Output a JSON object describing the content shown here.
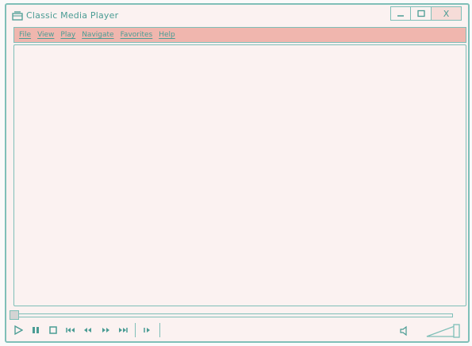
{
  "window": {
    "title": "Classic Media Player",
    "controls": [
      "minimize",
      "maximize",
      "close"
    ],
    "close_label": "X"
  },
  "menu": {
    "items": [
      "File",
      "View",
      "Play",
      "Navigate",
      "Favorites",
      "Help"
    ]
  },
  "seek": {
    "position_fraction": 0.0
  },
  "volume": {
    "level_fraction": 1.0
  },
  "icons": {
    "app": "media-player-icon",
    "play": "play-icon",
    "pause": "pause-icon",
    "stop": "stop-icon",
    "previous": "skip-previous-icon",
    "rewind": "rewind-icon",
    "forward": "fast-forward-icon",
    "next": "skip-next-icon",
    "frame_step": "frame-step-icon",
    "speaker": "speaker-icon"
  },
  "colors": {
    "accent": "#7fbfb8",
    "menubar": "#f0b6ae",
    "background": "#fbf2f1"
  }
}
